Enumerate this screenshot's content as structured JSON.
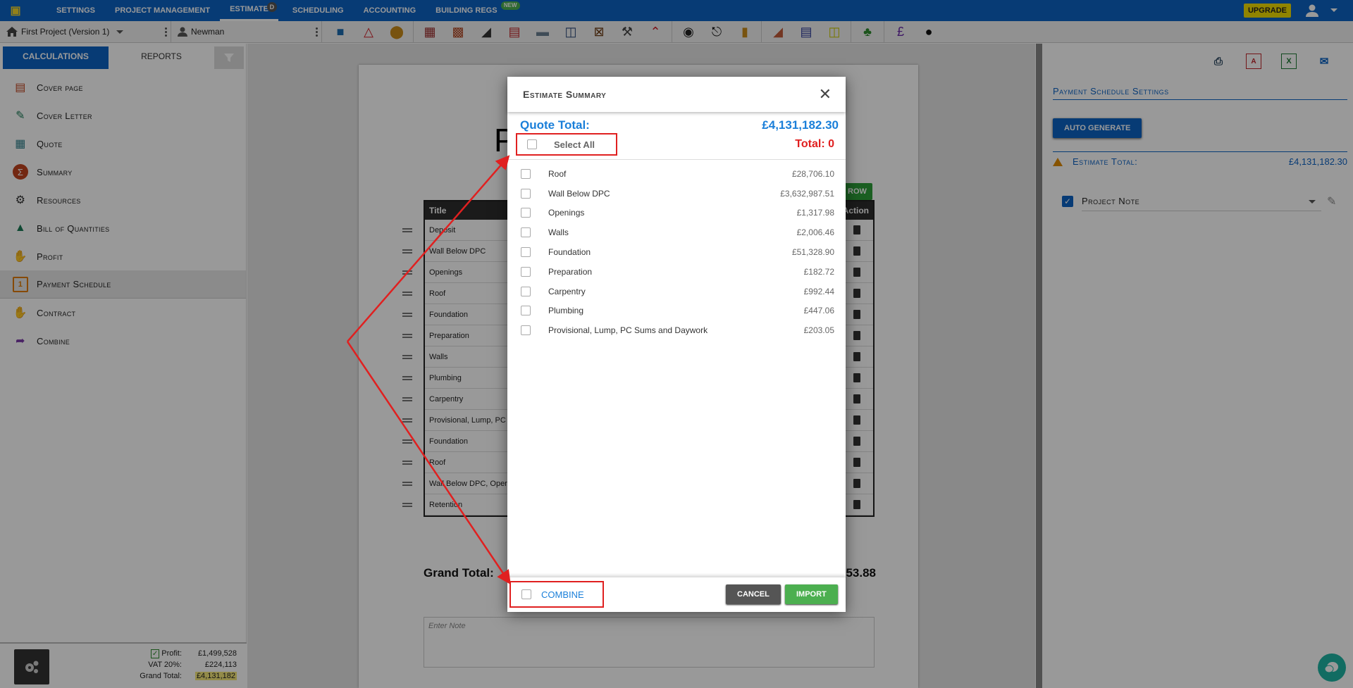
{
  "topnav": {
    "items": [
      {
        "label": "SETTINGS"
      },
      {
        "label": "PROJECT MANAGEMENT"
      },
      {
        "label": "ESTIMATE",
        "badge": "D",
        "active": true
      },
      {
        "label": "SCHEDULING"
      },
      {
        "label": "ACCOUNTING"
      },
      {
        "label": "BUILDING REGS",
        "badge": "NEW"
      }
    ],
    "upgrade_label": "UPGRADE"
  },
  "toolbar": {
    "project": "First Project (Version 1)",
    "client": "Newman",
    "tool_icons": [
      "contractor-icon",
      "warning-sign-icon",
      "pipe-icon",
      "piling-icon",
      "brick-pier-icon",
      "slab-icon",
      "brickwork-icon",
      "steel-beam-icon",
      "window-icon",
      "timber-frame-icon",
      "tools-icon",
      "roof-icon",
      "lighting-icon",
      "tap-icon",
      "boiler-icon",
      "plaster-icon",
      "staircase-icon",
      "measure-icon",
      "tree-icon",
      "coins-pound-icon",
      "person-icon"
    ]
  },
  "sidebar": {
    "tabs": {
      "calculations": "CALCULATIONS",
      "reports": "REPORTS"
    },
    "items": [
      {
        "label": "Cover page",
        "icon": "cover-page-icon",
        "color": "#c0441e"
      },
      {
        "label": "Cover Letter",
        "icon": "cover-letter-icon",
        "color": "#1a7a55"
      },
      {
        "label": "Quote",
        "icon": "quote-icon",
        "color": "#2f7f8a"
      },
      {
        "label": "Summary",
        "icon": "sigma-icon",
        "color": "#c0441e"
      },
      {
        "label": "Resources",
        "icon": "resources-icon",
        "color": "#333333"
      },
      {
        "label": "Bill of Quantities",
        "icon": "bill-of-quantities-icon",
        "color": "#1a7a55"
      },
      {
        "label": "Profit",
        "icon": "profit-icon",
        "color": "#c0162a"
      },
      {
        "label": "Payment Schedule",
        "icon": "calendar-icon",
        "color": "#e07b00",
        "selected": true
      },
      {
        "label": "Contract",
        "icon": "handshake-icon",
        "color": "#6b3510"
      },
      {
        "label": "Combine",
        "icon": "share-icon",
        "color": "#7b3aa8"
      }
    ],
    "footer": {
      "profit_label": "Profit:",
      "profit_value": "£1,499,528",
      "vat_label": "VAT 20%:",
      "vat_value": "£224,113",
      "grand_label": "Grand Total:",
      "grand_value": "£4,131,182"
    }
  },
  "document": {
    "title_partial": "P",
    "add_row_partial": "ROW",
    "table_headers": {
      "title": "Title",
      "action": "Action"
    },
    "rows": [
      "Deposit",
      "Wall Below DPC",
      "Openings",
      "Roof",
      "Foundation",
      "Preparation",
      "Walls",
      "Plumbing",
      "Carpentry",
      "Provisional, Lump, PC",
      "Foundation",
      "Roof",
      "Wall Below DPC, Oper",
      "Retention"
    ],
    "grand_total_label": "Grand Total:",
    "grand_total_partial": "53.88",
    "note_placeholder": "Enter Note"
  },
  "right_panel": {
    "heading": "Payment Schedule Settings",
    "auto_generate": "AUTO GENERATE",
    "estimate_total_label": "Estimate Total:",
    "estimate_total_value": "£4,131,182.30",
    "project_note_label": "Project Note",
    "project_note_checked": true
  },
  "modal": {
    "title": "Estimate Summary",
    "quote_total_label": "Quote Total:",
    "quote_total_value": "£4,131,182.30",
    "select_all_label": "Select All",
    "selected_total": "Total: 0",
    "items": [
      {
        "name": "Roof",
        "value": "£28,706.10",
        "checked": false
      },
      {
        "name": "Wall Below DPC",
        "value": "£3,632,987.51",
        "checked": false
      },
      {
        "name": "Openings",
        "value": "£1,317.98",
        "checked": false
      },
      {
        "name": "Walls",
        "value": "£2,006.46",
        "checked": false
      },
      {
        "name": "Foundation",
        "value": "£51,328.90",
        "checked": false
      },
      {
        "name": "Preparation",
        "value": "£182.72",
        "checked": false
      },
      {
        "name": "Carpentry",
        "value": "£992.44",
        "checked": false
      },
      {
        "name": "Plumbing",
        "value": "£447.06",
        "checked": false
      },
      {
        "name": "Provisional, Lump, PC Sums and Daywork",
        "value": "£203.05",
        "checked": false
      }
    ],
    "combine_label": "COMBINE",
    "cancel_label": "CANCEL",
    "import_label": "IMPORT"
  },
  "colors": {
    "brand_blue": "#0d63c4",
    "accent_blue": "#1a7fd9",
    "highlight_red": "#e02020",
    "import_green": "#4caf50",
    "upgrade_yellow": "#f0dc00"
  }
}
